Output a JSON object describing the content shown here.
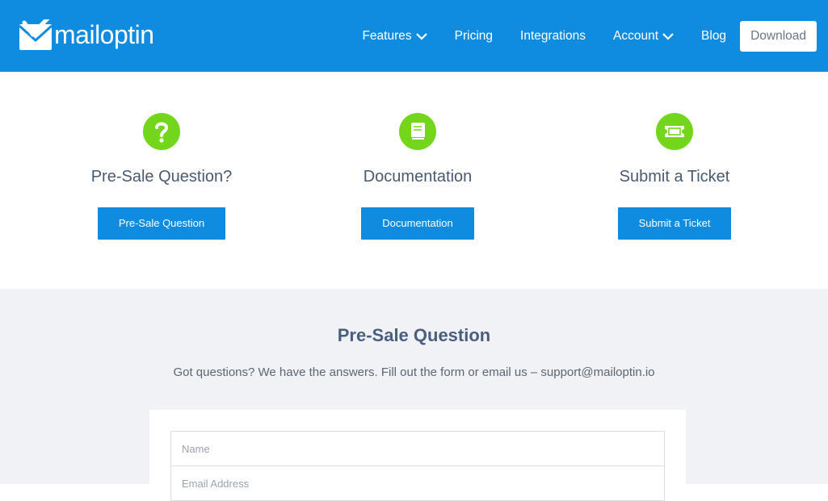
{
  "header": {
    "logo_text": "mailoptin",
    "nav": [
      {
        "label": "Features",
        "dropdown": true
      },
      {
        "label": "Pricing",
        "dropdown": false
      },
      {
        "label": "Integrations",
        "dropdown": false
      },
      {
        "label": "Account",
        "dropdown": true
      },
      {
        "label": "Blog",
        "dropdown": false
      }
    ],
    "download_label": "Download"
  },
  "cards": [
    {
      "icon": "question-icon",
      "title": "Pre-Sale Question?",
      "button": "Pre-Sale Question"
    },
    {
      "icon": "book-icon",
      "title": "Documentation",
      "button": "Documentation"
    },
    {
      "icon": "ticket-icon",
      "title": "Submit a Ticket",
      "button": "Submit a Ticket"
    }
  ],
  "presale": {
    "title": "Pre-Sale Question",
    "subtitle": "Got questions? We have the answers. Fill out the form or email us – support@mailoptin.io",
    "name_placeholder": "Name",
    "email_placeholder": "Email Address"
  },
  "colors": {
    "brand_blue": "#0f8ce0",
    "accent_green": "#74d61a",
    "section_bg": "#f0f2f5"
  }
}
